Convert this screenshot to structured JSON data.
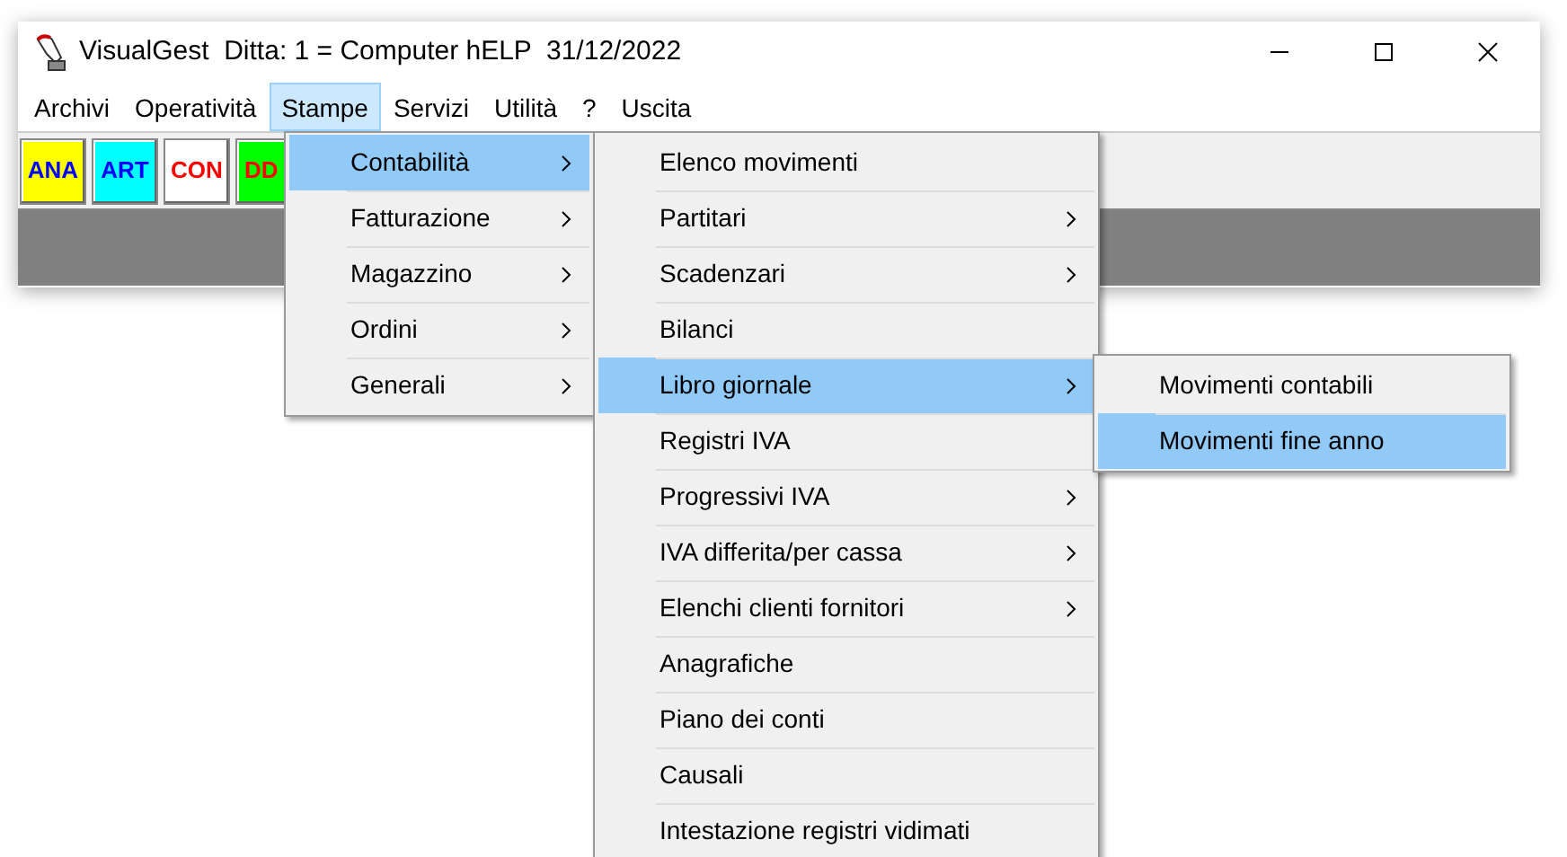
{
  "window": {
    "title": "VisualGest  Ditta: 1 = Computer hELP  31/12/2022"
  },
  "menubar": [
    {
      "label": "Archivi",
      "selected": false
    },
    {
      "label": "Operatività",
      "selected": false
    },
    {
      "label": "Stampe",
      "selected": true
    },
    {
      "label": "Servizi",
      "selected": false
    },
    {
      "label": "Utilità",
      "selected": false
    },
    {
      "label": "?",
      "selected": false
    },
    {
      "label": "Uscita",
      "selected": false
    }
  ],
  "toolbar": [
    {
      "label": "ANA",
      "color": "#ffff00",
      "kind": "blue"
    },
    {
      "label": "ART",
      "color": "#00ffff",
      "kind": "blue"
    },
    {
      "label": "CON",
      "color": "#ffffff",
      "kind": "red"
    },
    {
      "label": "DD",
      "color": "#00ff00",
      "kind": "red"
    }
  ],
  "menus": [
    {
      "items": [
        {
          "label": "Contabilità",
          "selected": true,
          "submenu": true
        },
        {
          "label": "Fatturazione",
          "selected": false,
          "submenu": true
        },
        {
          "label": "Magazzino",
          "selected": false,
          "submenu": true
        },
        {
          "label": "Ordini",
          "selected": false,
          "submenu": true
        },
        {
          "label": "Generali",
          "selected": false,
          "submenu": true
        }
      ]
    },
    {
      "items": [
        {
          "label": "Elenco movimenti",
          "selected": false,
          "submenu": false
        },
        {
          "label": "Partitari",
          "selected": false,
          "submenu": true
        },
        {
          "label": "Scadenzari",
          "selected": false,
          "submenu": true
        },
        {
          "label": "Bilanci",
          "selected": false,
          "submenu": false
        },
        {
          "label": "Libro giornale",
          "selected": true,
          "submenu": true
        },
        {
          "label": "Registri IVA",
          "selected": false,
          "submenu": false
        },
        {
          "label": "Progressivi IVA",
          "selected": false,
          "submenu": true
        },
        {
          "label": "IVA differita/per cassa",
          "selected": false,
          "submenu": true
        },
        {
          "label": "Elenchi clienti fornitori",
          "selected": false,
          "submenu": true
        },
        {
          "label": "Anagrafiche",
          "selected": false,
          "submenu": false
        },
        {
          "label": "Piano dei conti",
          "selected": false,
          "submenu": false
        },
        {
          "label": "Causali",
          "selected": false,
          "submenu": false
        },
        {
          "label": "Intestazione registri vidimati",
          "selected": false,
          "submenu": false
        }
      ]
    },
    {
      "items": [
        {
          "label": "Movimenti contabili",
          "selected": false,
          "submenu": false
        },
        {
          "label": "Movimenti fine anno",
          "selected": true,
          "submenu": false
        }
      ]
    }
  ]
}
